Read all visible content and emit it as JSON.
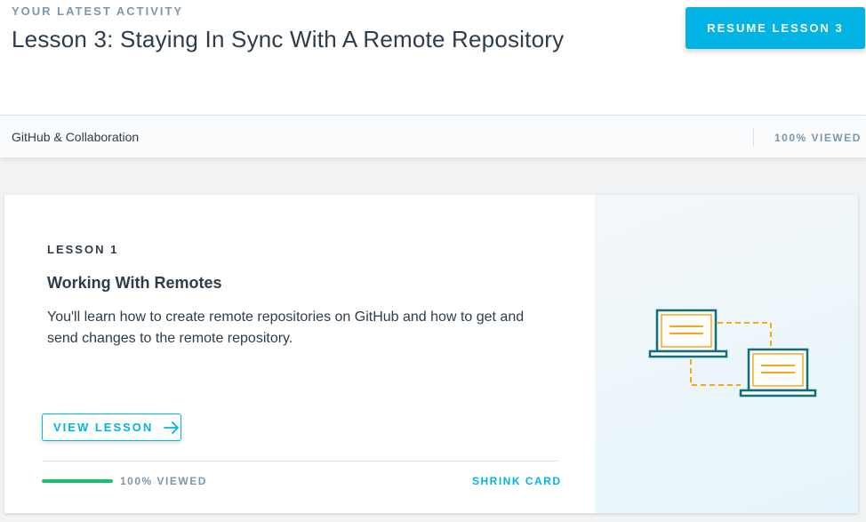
{
  "header": {
    "eyebrow": "YOUR LATEST ACTIVITY",
    "title": "Lesson 3: Staying In Sync With A Remote Repository",
    "resume_button": "RESUME LESSON 3"
  },
  "course_bar": {
    "name": "GitHub & Collaboration",
    "viewed": "100% VIEWED"
  },
  "lesson_card": {
    "lesson_number": "LESSON 1",
    "title": "Working With Remotes",
    "description": "You'll learn how to create remote repositories on GitHub and how to get and send changes to the remote repository.",
    "view_button": "VIEW LESSON",
    "progress_percent": 100,
    "viewed": "100% VIEWED",
    "shrink": "SHRINK CARD",
    "illustration": "two-laptops-sync-icon"
  },
  "colors": {
    "accent": "#02b3e4",
    "progress": "#15c26b",
    "text": "#2e3d49",
    "muted": "#7d97ad",
    "laptop_outline": "#0f6f78",
    "laptop_screen": "#f7a71b"
  }
}
